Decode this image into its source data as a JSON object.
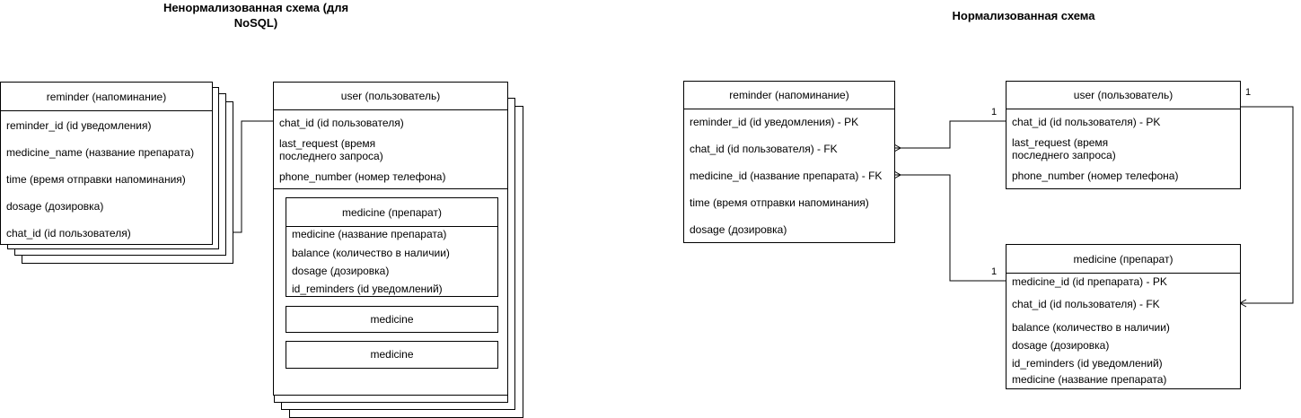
{
  "titles": {
    "left_line1": "Ненормализованная схема (для",
    "left_line2": "NoSQL)",
    "right": "Нормализованная схема"
  },
  "left": {
    "reminder": {
      "header": "reminder (напоминание)",
      "fields": [
        "reminder_id (id уведомления)",
        "medicine_name (название препарата)",
        "time (время отправки напоминания)",
        "dosage (дозировка)",
        "chat_id (id пользователя)"
      ]
    },
    "user": {
      "header": "user (пользователь)",
      "fields": [
        "chat_id (id пользователя)",
        "last_request (время последнего запроса)",
        "phone_number (номер телефона)"
      ]
    },
    "medicine": {
      "header": "medicine (препарат)",
      "fields": [
        "medicine (название препарата)",
        "balance (количество в наличии)",
        "dosage (дозировка)",
        "id_reminders (id уведомлений)"
      ]
    },
    "medicine_stub_1": "medicine",
    "medicine_stub_2": "medicine"
  },
  "right": {
    "reminder": {
      "header": "reminder (напоминание)",
      "fields": [
        "reminder_id (id уведомления) - PK",
        "chat_id (id пользователя) - FK",
        "medicine_id (название препарата) - FK",
        "time (время отправки напоминания)",
        "dosage (дозировка)"
      ]
    },
    "user": {
      "header": "user (пользователь)",
      "fields": [
        "chat_id (id пользователя) - PK",
        "last_request (время последнего запроса)",
        "phone_number (номер телефона)"
      ]
    },
    "medicine": {
      "header": "medicine (препарат)",
      "fields": [
        "medicine_id (id препарата) - PK",
        "chat_id (id пользователя) - FK",
        "balance (количество в наличии)",
        "dosage (дозировка)",
        "id_reminders (id уведомлений)",
        "medicine (название препарата)"
      ]
    },
    "cardinality": {
      "user_reminder": "1",
      "medicine_reminder": "1",
      "user_medicine": "1"
    }
  }
}
